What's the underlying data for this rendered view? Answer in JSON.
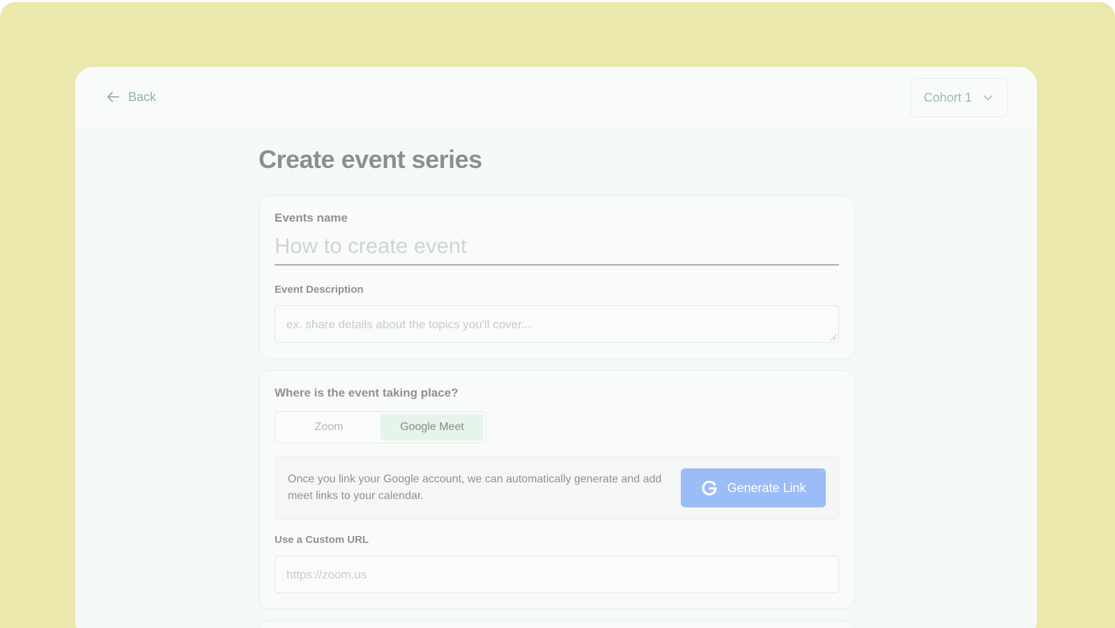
{
  "header": {
    "back_label": "Back",
    "cohort_selected": "Cohort 1"
  },
  "page": {
    "title": "Create event series"
  },
  "details_card": {
    "name_label": "Events name",
    "name_placeholder": "How to create event",
    "description_label": "Event Description",
    "description_placeholder": "ex. share details about the topics you'll cover..."
  },
  "location_card": {
    "question": "Where is the event taking place?",
    "options": [
      {
        "label": "Zoom",
        "selected": false
      },
      {
        "label": "Google Meet",
        "selected": true
      }
    ],
    "info_text": "Once you link your Google account, we can automatically generate and add meet links to your calendar.",
    "generate_button_label": "Generate Link",
    "custom_url_label": "Use a Custom URL",
    "custom_url_placeholder": "https://zoom.us"
  },
  "colors": {
    "backdrop": "#ebe8ae",
    "accent_button": "#9cbcf7",
    "selected_option": "#e7f4ec"
  },
  "icons": {
    "back": "arrow-left-icon",
    "cohort": "chevron-down-icon",
    "generate": "google-g-icon"
  }
}
